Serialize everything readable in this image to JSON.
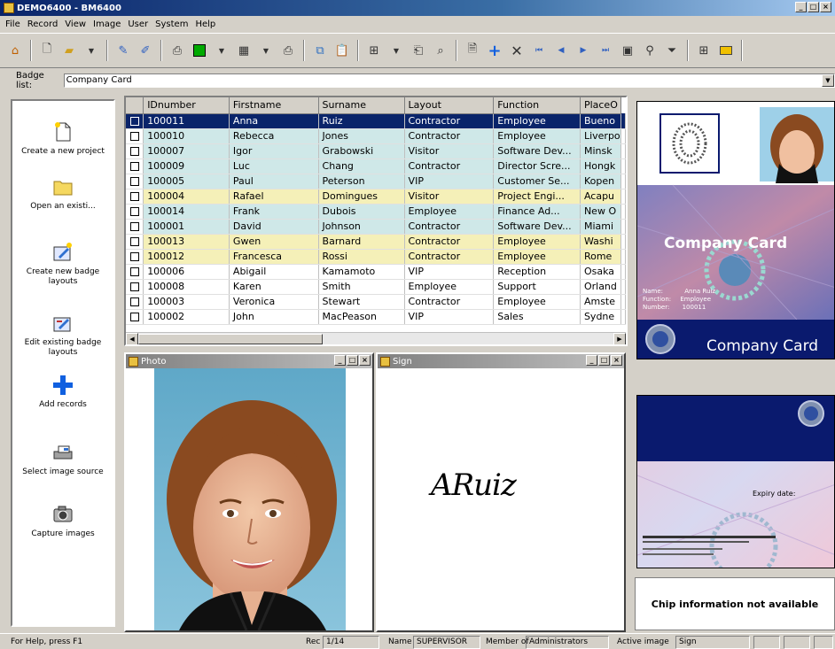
{
  "window": {
    "title": "DEMO6400 - BM6400"
  },
  "menu": [
    "File",
    "Record",
    "View",
    "Image",
    "User",
    "System",
    "Help"
  ],
  "badge_list": {
    "label": "Badge list:",
    "value": "Company Card"
  },
  "left_panel": {
    "items": [
      {
        "label": "Create a new project",
        "icon": "new-project-icon"
      },
      {
        "label": "Open an existi...",
        "icon": "folder-icon"
      },
      {
        "label": "Create new badge layouts",
        "icon": "new-layout-icon"
      },
      {
        "label": "Edit existing badge layouts",
        "icon": "edit-layout-icon"
      },
      {
        "label": "Add records",
        "icon": "plus-icon"
      },
      {
        "label": "Select image source",
        "icon": "scanner-icon"
      },
      {
        "label": "Capture images",
        "icon": "camera-icon"
      }
    ]
  },
  "table": {
    "columns": [
      "IDnumber",
      "Firstname",
      "Surname",
      "Layout",
      "Function",
      "PlaceO"
    ],
    "rows": [
      [
        "100011",
        "Anna",
        "Ruiz",
        "Contractor",
        "Employee",
        "Bueno"
      ],
      [
        "100010",
        "Rebecca",
        "Jones",
        "Contractor",
        "Employee",
        "Liverpo"
      ],
      [
        "100007",
        "Igor",
        "Grabowski",
        "Visitor",
        "Software Dev...",
        "Minsk"
      ],
      [
        "100009",
        "Luc",
        "Chang",
        "Contractor",
        "Director Scre...",
        "Hongk"
      ],
      [
        "100005",
        "Paul",
        "Peterson",
        "VIP",
        "Customer Se...",
        "Kopen"
      ],
      [
        "100004",
        "Rafael",
        "Domingues",
        "Visitor",
        "Project Engi...",
        "Acapu"
      ],
      [
        "100014",
        "Frank",
        "Dubois",
        "Employee",
        "Finance Ad...",
        "New O"
      ],
      [
        "100001",
        "David",
        "Johnson",
        "Contractor",
        "Software Dev...",
        "Miami"
      ],
      [
        "100013",
        "Gwen",
        "Barnard",
        "Contractor",
        "Employee",
        "Washi"
      ],
      [
        "100012",
        "Francesca",
        "Rossi",
        "Contractor",
        "Employee",
        "Rome"
      ],
      [
        "100006",
        "Abigail",
        "Kamamoto",
        "VIP",
        "Reception",
        "Osaka"
      ],
      [
        "100008",
        "Karen",
        "Smith",
        "Employee",
        "Support",
        "Orland"
      ],
      [
        "100003",
        "Veronica",
        "Stewart",
        "Contractor",
        "Employee",
        "Amste"
      ],
      [
        "100002",
        "John",
        "MacPeason",
        "VIP",
        "Sales",
        "Sydne"
      ]
    ],
    "row_colors": [
      "sel",
      "#cfe8e8",
      "#cfe8e8",
      "#cfe8e8",
      "#cfe8e8",
      "#f5f0b8",
      "#cfe8e8",
      "#cfe8e8",
      "#f5f0b8",
      "#f5f0b8",
      "#ffffff",
      "#ffffff",
      "#ffffff",
      "#ffffff"
    ]
  },
  "photo_window": {
    "title": "Photo"
  },
  "sign_window": {
    "title": "Sign",
    "signature": "ARuiz"
  },
  "front_badge": {
    "brand": "Company Card",
    "name_label": "Name:",
    "name_value": "Anna Ruiz",
    "function_label": "Function:",
    "function_value": "Employee",
    "number_label": "Number:",
    "number_value": "100011",
    "footer": "Company Card"
  },
  "back_badge": {
    "expiry_label": "Expiry date:"
  },
  "chip_text": "Chip information not available",
  "status": {
    "help": "For Help, press F1",
    "rec_label": "Rec",
    "rec_value": "1/14",
    "name_label": "Name",
    "name_value": "SUPERVISOR",
    "member_label": "Member of",
    "member_value": "Administrators",
    "active_label": "Active image",
    "active_value": "Sign"
  },
  "colors": {
    "selection": "#0a246a",
    "badge_navy": "#0a1a6e",
    "badge_title": "#ffffff"
  }
}
